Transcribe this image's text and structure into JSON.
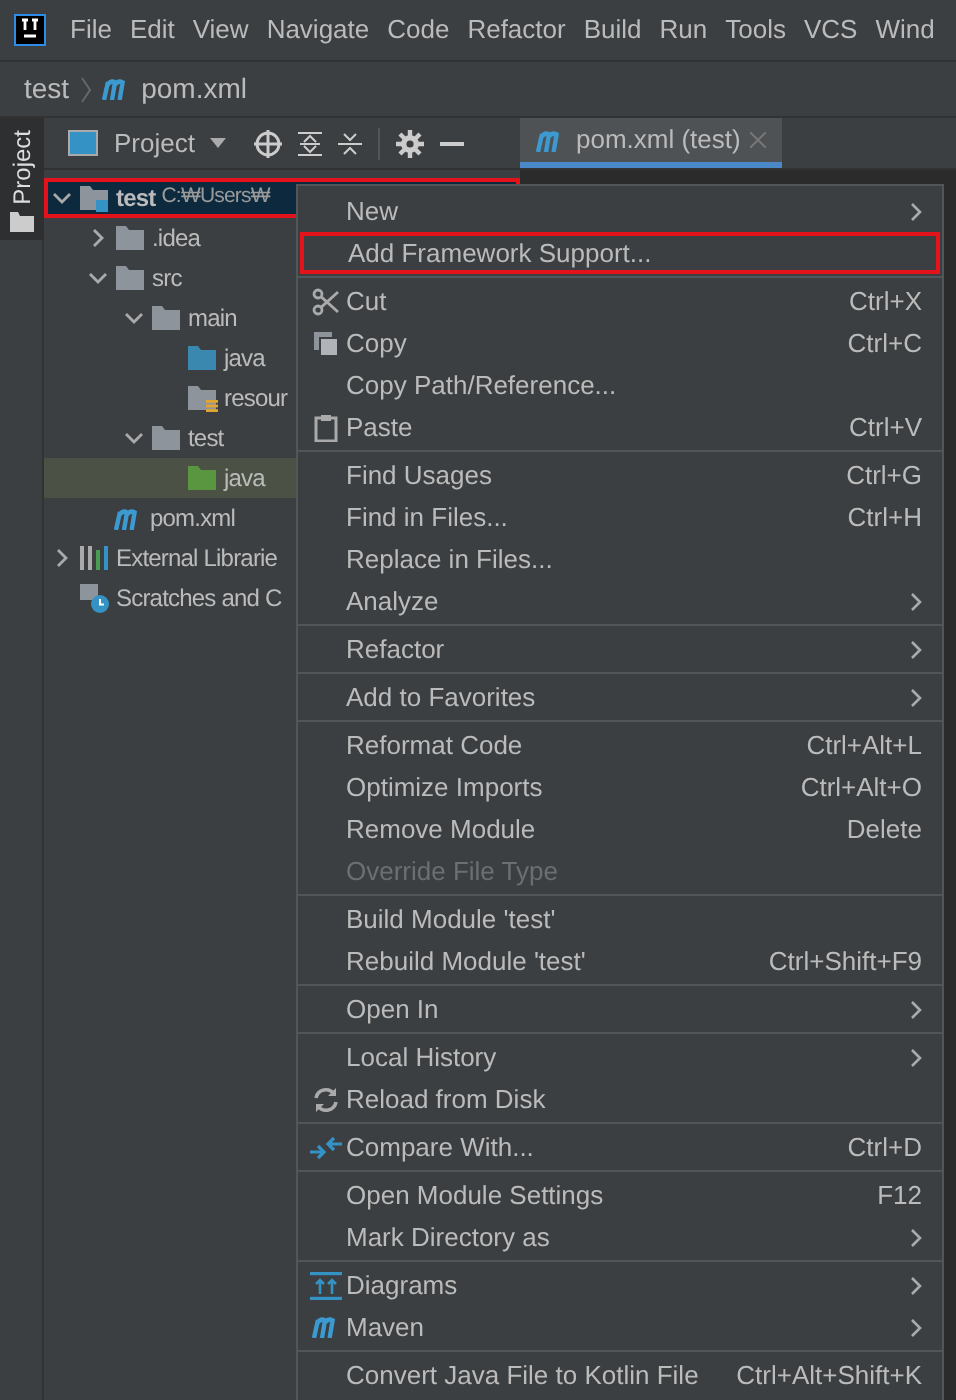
{
  "menu_bar": [
    "File",
    "Edit",
    "View",
    "Navigate",
    "Code",
    "Refactor",
    "Build",
    "Run",
    "Tools",
    "VCS",
    "Wind"
  ],
  "breadcrumb": [
    {
      "label": "test",
      "kind": "plain"
    },
    {
      "label": "pom.xml",
      "kind": "maven"
    }
  ],
  "side_strip": {
    "label": "Project"
  },
  "tool_window": {
    "title": "Project"
  },
  "editor_tab": {
    "label": "pom.xml (test)",
    "selected": true
  },
  "tree": [
    {
      "label": "test",
      "suffix": "C:₩Users₩",
      "kind": "module",
      "expanded": true,
      "selected": false,
      "highlighted": true,
      "children": [
        {
          "label": ".idea",
          "kind": "folder",
          "expanded": false,
          "selected": false,
          "highlighted": false
        },
        {
          "label": "src",
          "kind": "folder",
          "expanded": true,
          "selected": false,
          "highlighted": false,
          "children": [
            {
              "label": "main",
              "kind": "folder",
              "expanded": true,
              "selected": false,
              "highlighted": false,
              "children": [
                {
                  "label": "java",
                  "kind": "source",
                  "selected": false,
                  "highlighted": false
                },
                {
                  "label": "resour",
                  "kind": "resource",
                  "selected": false,
                  "highlighted": false
                }
              ]
            },
            {
              "label": "test",
              "kind": "folder",
              "expanded": true,
              "selected": false,
              "highlighted": false,
              "children": [
                {
                  "label": "java",
                  "kind": "test",
                  "selected": true,
                  "highlighted": false
                }
              ]
            }
          ]
        },
        {
          "label": "pom.xml",
          "kind": "maven",
          "selected": false,
          "highlighted": false
        }
      ]
    },
    {
      "label": "External Librarie",
      "kind": "libraries",
      "expanded": false,
      "selected": false,
      "highlighted": false
    },
    {
      "label": "Scratches and C",
      "kind": "scratches",
      "selected": false,
      "highlighted": false
    }
  ],
  "context_menu": [
    {
      "kind": "plain",
      "label": "New",
      "submenu": true,
      "highlighted": false,
      "disabled": false
    },
    {
      "kind": "plain",
      "label": "Add Framework Support...",
      "submenu": false,
      "highlighted": true,
      "disabled": false
    },
    {
      "kind": "separator"
    },
    {
      "kind": "scissors",
      "label": "Cut",
      "shortcut": "Ctrl+X",
      "submenu": false,
      "highlighted": false,
      "disabled": false
    },
    {
      "kind": "copy",
      "label": "Copy",
      "shortcut": "Ctrl+C",
      "submenu": false,
      "highlighted": false,
      "disabled": false
    },
    {
      "kind": "plain",
      "label": "Copy Path/Reference...",
      "submenu": false,
      "highlighted": false,
      "disabled": false
    },
    {
      "kind": "paste",
      "label": "Paste",
      "shortcut": "Ctrl+V",
      "submenu": false,
      "highlighted": false,
      "disabled": false
    },
    {
      "kind": "separator"
    },
    {
      "kind": "plain",
      "label": "Find Usages",
      "shortcut": "Ctrl+G",
      "submenu": false,
      "highlighted": false,
      "disabled": false
    },
    {
      "kind": "plain",
      "label": "Find in Files...",
      "shortcut": "Ctrl+H",
      "submenu": false,
      "highlighted": false,
      "disabled": false
    },
    {
      "kind": "plain",
      "label": "Replace in Files...",
      "submenu": false,
      "highlighted": false,
      "disabled": false
    },
    {
      "kind": "plain",
      "label": "Analyze",
      "submenu": true,
      "highlighted": false,
      "disabled": false
    },
    {
      "kind": "separator"
    },
    {
      "kind": "plain",
      "label": "Refactor",
      "submenu": true,
      "highlighted": false,
      "disabled": false
    },
    {
      "kind": "separator"
    },
    {
      "kind": "plain",
      "label": "Add to Favorites",
      "submenu": true,
      "highlighted": false,
      "disabled": false
    },
    {
      "kind": "separator"
    },
    {
      "kind": "plain",
      "label": "Reformat Code",
      "shortcut": "Ctrl+Alt+L",
      "submenu": false,
      "highlighted": false,
      "disabled": false
    },
    {
      "kind": "plain",
      "label": "Optimize Imports",
      "shortcut": "Ctrl+Alt+O",
      "submenu": false,
      "highlighted": false,
      "disabled": false
    },
    {
      "kind": "plain",
      "label": "Remove Module",
      "shortcut": "Delete",
      "submenu": false,
      "highlighted": false,
      "disabled": false
    },
    {
      "kind": "plain",
      "label": "Override File Type",
      "submenu": false,
      "highlighted": false,
      "disabled": true
    },
    {
      "kind": "separator"
    },
    {
      "kind": "plain",
      "label": "Build Module 'test'",
      "submenu": false,
      "highlighted": false,
      "disabled": false
    },
    {
      "kind": "plain",
      "label": "Rebuild Module 'test'",
      "shortcut": "Ctrl+Shift+F9",
      "submenu": false,
      "highlighted": false,
      "disabled": false
    },
    {
      "kind": "separator"
    },
    {
      "kind": "plain",
      "label": "Open In",
      "submenu": true,
      "highlighted": false,
      "disabled": false
    },
    {
      "kind": "separator"
    },
    {
      "kind": "plain",
      "label": "Local History",
      "submenu": true,
      "highlighted": false,
      "disabled": false
    },
    {
      "kind": "reload",
      "label": "Reload from Disk",
      "submenu": false,
      "highlighted": false,
      "disabled": false
    },
    {
      "kind": "separator"
    },
    {
      "kind": "compare",
      "label": "Compare With...",
      "shortcut": "Ctrl+D",
      "submenu": false,
      "highlighted": false,
      "disabled": false
    },
    {
      "kind": "separator"
    },
    {
      "kind": "plain",
      "label": "Open Module Settings",
      "shortcut": "F12",
      "submenu": false,
      "highlighted": false,
      "disabled": false
    },
    {
      "kind": "plain",
      "label": "Mark Directory as",
      "submenu": true,
      "highlighted": false,
      "disabled": false
    },
    {
      "kind": "separator"
    },
    {
      "kind": "diagram",
      "label": "Diagrams",
      "submenu": true,
      "highlighted": false,
      "disabled": false
    },
    {
      "kind": "maven",
      "label": "Maven",
      "submenu": true,
      "highlighted": false,
      "disabled": false
    },
    {
      "kind": "separator"
    },
    {
      "kind": "plain",
      "label": "Convert Java File to Kotlin File",
      "shortcut": "Ctrl+Alt+Shift+K",
      "submenu": false,
      "highlighted": false,
      "disabled": false
    }
  ]
}
